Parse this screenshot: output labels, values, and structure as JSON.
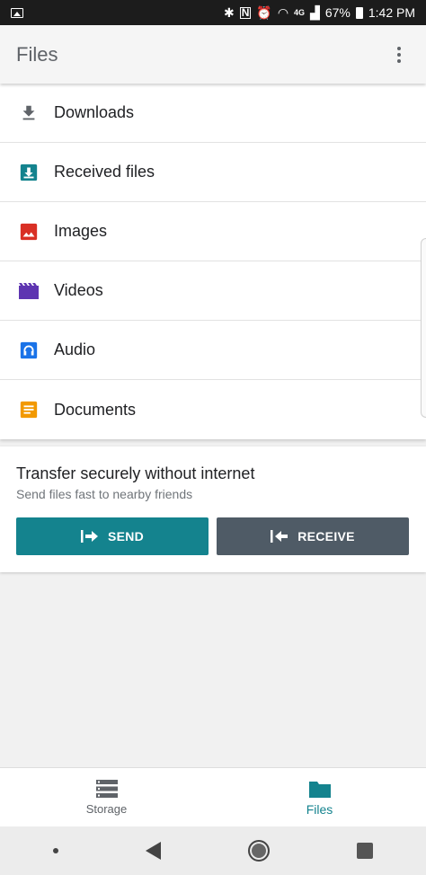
{
  "status_bar": {
    "battery": "67%",
    "time": "1:42 PM",
    "network": "4G"
  },
  "app_bar": {
    "title": "Files"
  },
  "categories": [
    {
      "label": "Downloads",
      "icon": "download-icon",
      "color": "#5f6368"
    },
    {
      "label": "Received files",
      "icon": "received-files-icon",
      "color": "#14838e"
    },
    {
      "label": "Images",
      "icon": "image-icon",
      "color": "#d93025"
    },
    {
      "label": "Videos",
      "icon": "video-icon",
      "color": "#5e35b1"
    },
    {
      "label": "Audio",
      "icon": "headphones-icon",
      "color": "#1a73e8"
    },
    {
      "label": "Documents",
      "icon": "document-icon",
      "color": "#f29900"
    }
  ],
  "transfer": {
    "title": "Transfer securely without internet",
    "subtitle": "Send files fast to nearby friends",
    "send_label": "SEND",
    "receive_label": "RECEIVE",
    "send_color": "#14838e",
    "receive_color": "#4f5b66"
  },
  "bottom_nav": {
    "items": [
      {
        "label": "Storage",
        "icon": "storage-icon",
        "active": false
      },
      {
        "label": "Files",
        "icon": "folder-icon",
        "active": true
      }
    ]
  }
}
